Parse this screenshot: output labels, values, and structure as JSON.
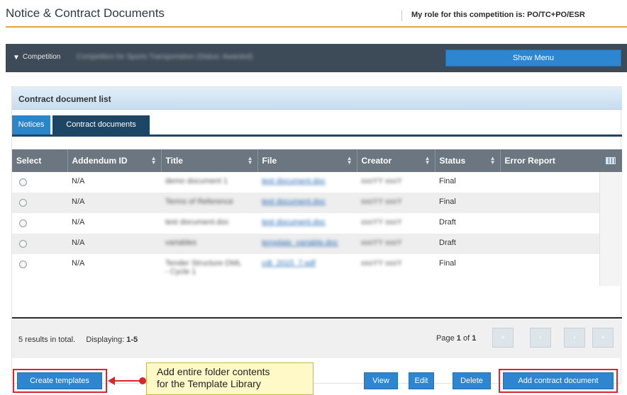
{
  "header": {
    "title": "Notice & Contract Documents",
    "role_text": "My role for this competition is: PO/TC+PO/ESR"
  },
  "competition_bar": {
    "label": "Competition",
    "name": "Competition for Sports Transportation (Status: Awarded)",
    "show_menu_label": "Show Menu"
  },
  "panel": {
    "title": "Contract document list",
    "tabs": [
      {
        "label": "Notices",
        "active": false
      },
      {
        "label": "Contract documents",
        "active": true
      }
    ]
  },
  "table": {
    "columns": [
      "Select",
      "Addendum ID",
      "Title",
      "File",
      "Creator",
      "Status",
      "Error Report"
    ],
    "rows": [
      {
        "addendum_id": "N/A",
        "title": "demo document 1",
        "file": "test document.doc",
        "creator": "xxxYY xxxY",
        "status": "Final",
        "error_report": ""
      },
      {
        "addendum_id": "N/A",
        "title": "Terms of Reference",
        "file": "test document.doc",
        "creator": "xxxYY xxxY",
        "status": "Final",
        "error_report": ""
      },
      {
        "addendum_id": "N/A",
        "title": "test document.doc",
        "file": "test document.doc",
        "creator": "xxxYY xxxY",
        "status": "Draft",
        "error_report": ""
      },
      {
        "addendum_id": "N/A",
        "title": "variables",
        "file": "template_variable.doc",
        "creator": "xxxYY xxxY",
        "status": "Draft",
        "error_report": ""
      },
      {
        "addendum_id": "N/A",
        "title": "Tender Structure DML - Cycle 1",
        "file": "cdt_2015_7.pdf",
        "creator": "xxxYY xxxY",
        "status": "Final",
        "error_report": ""
      }
    ]
  },
  "footer": {
    "results_text": "5 results in total.",
    "displaying_label": "Displaying:",
    "displaying_range": "1-5",
    "page_label": "Page",
    "page_current": "1",
    "page_of": "of",
    "page_total": "1"
  },
  "actions": {
    "create_templates": "Create templates",
    "view": "View",
    "edit": "Edit",
    "delete": "Delete",
    "add_contract_document": "Add contract document"
  },
  "callout": {
    "line1": "Add entire folder contents",
    "line2": "for the Template Library"
  },
  "colors": {
    "accent_orange": "#e6a43a",
    "primary_blue": "#2e86d1",
    "dark_navy": "#1d4664",
    "highlight_red": "#d9262c",
    "callout_yellow": "#fff9c8"
  }
}
